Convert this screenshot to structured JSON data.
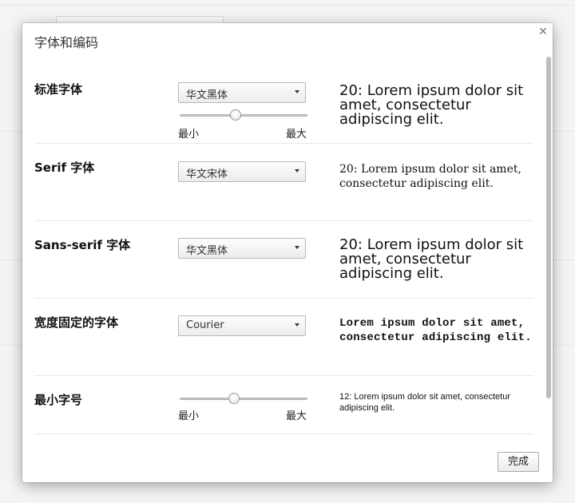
{
  "dialog": {
    "title": "字体和编码",
    "close_icon": "close-icon",
    "done_label": "完成"
  },
  "rows": {
    "standard": {
      "label": "标准字体",
      "font_value": "华文黑体",
      "slider_min": "最小",
      "slider_max": "最大",
      "slider_level": 0.43,
      "preview": "20: Lorem ipsum dolor sit amet, consectetur adipiscing elit."
    },
    "serif": {
      "label": "Serif 字体",
      "font_value": "华文宋体",
      "preview": "20: Lorem ipsum dolor sit amet, consectetur adipiscing elit."
    },
    "sans_serif": {
      "label": "Sans-serif 字体",
      "font_value": "华文黑体",
      "preview": "20: Lorem ipsum dolor sit amet, consectetur adipiscing elit."
    },
    "fixed_width": {
      "label": "宽度固定的字体",
      "font_value": "Courier",
      "preview": "Lorem ipsum dolor sit amet, consectetur adipiscing elit."
    },
    "minimum_size": {
      "label": "最小字号",
      "slider_min": "最小",
      "slider_max": "最大",
      "slider_level": 0.42,
      "preview": "12: Lorem ipsum dolor sit amet, consectetur adipiscing elit."
    }
  },
  "colors": {
    "dialog_bg": "#ffffff",
    "overlay_bg": "#ececec",
    "scrollbar": "#bdbdbd"
  }
}
